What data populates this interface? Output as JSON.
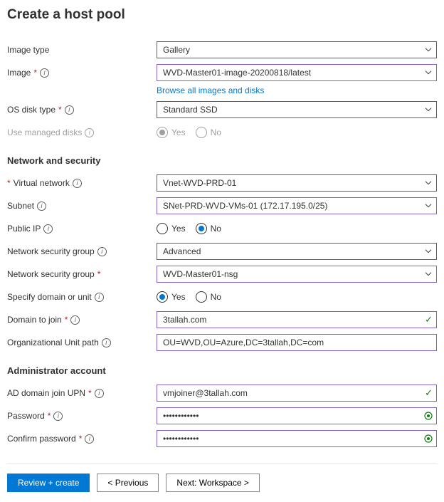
{
  "title": "Create a host pool",
  "labels": {
    "imageType": "Image type",
    "image": "Image",
    "osDiskType": "OS disk type",
    "useManagedDisks": "Use managed disks",
    "networkSecurity": "Network and security",
    "virtualNetwork": "Virtual network",
    "subnet": "Subnet",
    "publicIp": "Public IP",
    "nsg": "Network security group",
    "nsg2": "Network security group",
    "specifyDomain": "Specify domain or unit",
    "domainToJoin": "Domain to join",
    "ouPath": "Organizational Unit path",
    "adminAccount": "Administrator account",
    "adUpn": "AD domain join UPN",
    "password": "Password",
    "confirmPassword": "Confirm password"
  },
  "values": {
    "imageType": "Gallery",
    "image": "WVD-Master01-image-20200818/latest",
    "browseLink": "Browse all images and disks",
    "osDiskType": "Standard SSD",
    "virtualNetwork": "Vnet-WVD-PRD-01",
    "subnet": "SNet-PRD-WVD-VMs-01 (172.17.195.0/25)",
    "nsg": "Advanced",
    "nsg2": "WVD-Master01-nsg",
    "domainToJoin": "3tallah.com",
    "ouPath": "OU=WVD,OU=Azure,DC=3tallah,DC=com",
    "adUpn": "vmjoiner@3tallah.com",
    "password": "••••••••••••",
    "confirmPassword": "••••••••••••"
  },
  "radios": {
    "yes": "Yes",
    "no": "No"
  },
  "buttons": {
    "reviewCreate": "Review + create",
    "previous": "< Previous",
    "next": "Next: Workspace >"
  }
}
